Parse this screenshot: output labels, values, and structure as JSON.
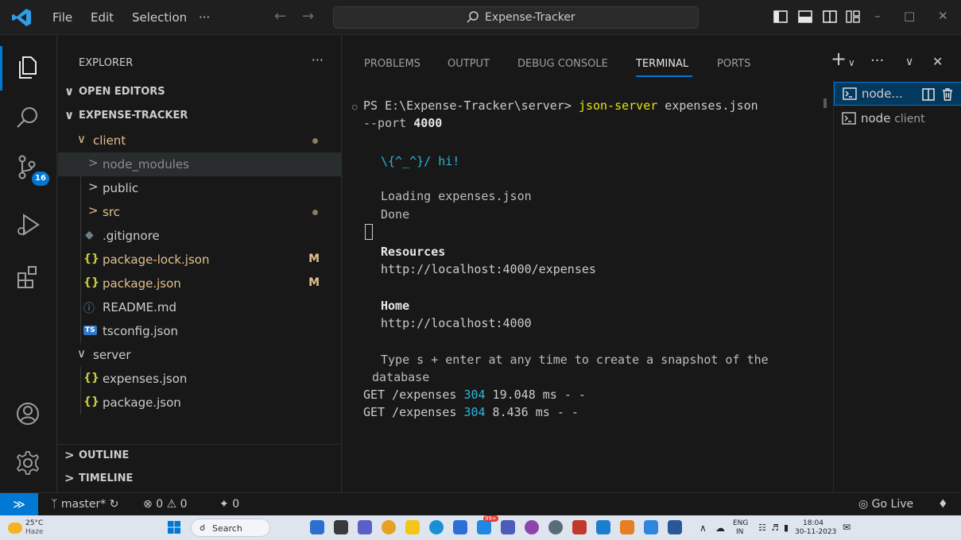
{
  "titlebar": {
    "menu": [
      "File",
      "Edit",
      "Selection",
      "···"
    ],
    "search_text": "Expense-Tracker",
    "window_controls": [
      "–",
      "□",
      "✕"
    ]
  },
  "activitybar": {
    "items": [
      "explorer-icon",
      "search-icon",
      "source-control-icon",
      "run-debug-icon",
      "extensions-icon",
      "account-icon",
      "settings-gear-icon"
    ],
    "scm_badge": "16",
    "accent": "#0078d4"
  },
  "explorer": {
    "title": "EXPLORER",
    "more": "···",
    "open_editors": "OPEN EDITORS",
    "root": "EXPENSE-TRACKER",
    "tree": [
      {
        "label": "client",
        "chev": "∨",
        "color": "#e2c08d"
      },
      {
        "label": "node_modules",
        "chev": ">",
        "color": "#8c8c8c"
      },
      {
        "label": "public",
        "chev": ">",
        "color": "#cccccc"
      },
      {
        "label": "src",
        "chev": ">",
        "color": "#e2c08d"
      },
      {
        "label": ".gitignore",
        "icon": "◆",
        "color": "#cccccc"
      },
      {
        "label": "package-lock.json",
        "icon": "{}",
        "color": "#e2c08d",
        "mark": "M"
      },
      {
        "label": "package.json",
        "icon": "{}",
        "color": "#e2c08d",
        "mark": "M"
      },
      {
        "label": "README.md",
        "icon": "ⓘ",
        "color": "#cccccc"
      },
      {
        "label": "tsconfig.json",
        "icon": "TS",
        "color": "#cccccc"
      },
      {
        "label": "server",
        "chev": "∨",
        "color": "#cccccc"
      },
      {
        "label": "expenses.json",
        "icon": "{}",
        "color": "#cccccc"
      },
      {
        "label": "package.json",
        "icon": "{}",
        "color": "#cccccc"
      }
    ],
    "outline": "OUTLINE",
    "timeline": "TIMELINE"
  },
  "panel": {
    "tabs": [
      "PROBLEMS",
      "OUTPUT",
      "DEBUG CONSOLE",
      "TERMINAL",
      "PORTS"
    ],
    "active_tab": "TERMINAL",
    "terminal": {
      "prompt": "PS E:\\Expense-Tracker\\server> ",
      "cmd": "json-server",
      "args1": " expenses.json",
      "args2": "--port ",
      "port": "4000",
      "hi": "\\{^_^}/ hi!",
      "loading": "Loading expenses.json",
      "done": "Done",
      "resources_h": "Resources",
      "resources_url": "http://localhost:4000/expenses",
      "home_h": "Home",
      "home_url": "http://localhost:4000",
      "snapshot1": "Type s + enter at any time to create a snapshot of the",
      "snapshot2": "database",
      "log": [
        {
          "pre": "GET /expenses ",
          "code": "304",
          "post": " 19.048 ms - -"
        },
        {
          "pre": "GET /expenses ",
          "code": "304",
          "post": " 8.436 ms - -"
        }
      ]
    },
    "terminals": [
      {
        "name": "node...",
        "sub": ""
      },
      {
        "name": "node",
        "sub": "client"
      }
    ]
  },
  "statusbar": {
    "branch": "master*",
    "errors": "0",
    "warnings": "0",
    "ports": "0",
    "golive": "Go Live"
  },
  "taskbar": {
    "temp": "25°C",
    "weather": "Haze",
    "search": "Search",
    "lang1": "ENG",
    "lang2": "IN",
    "time": "18:04",
    "date": "30-11-2023",
    "badge": "99+"
  }
}
